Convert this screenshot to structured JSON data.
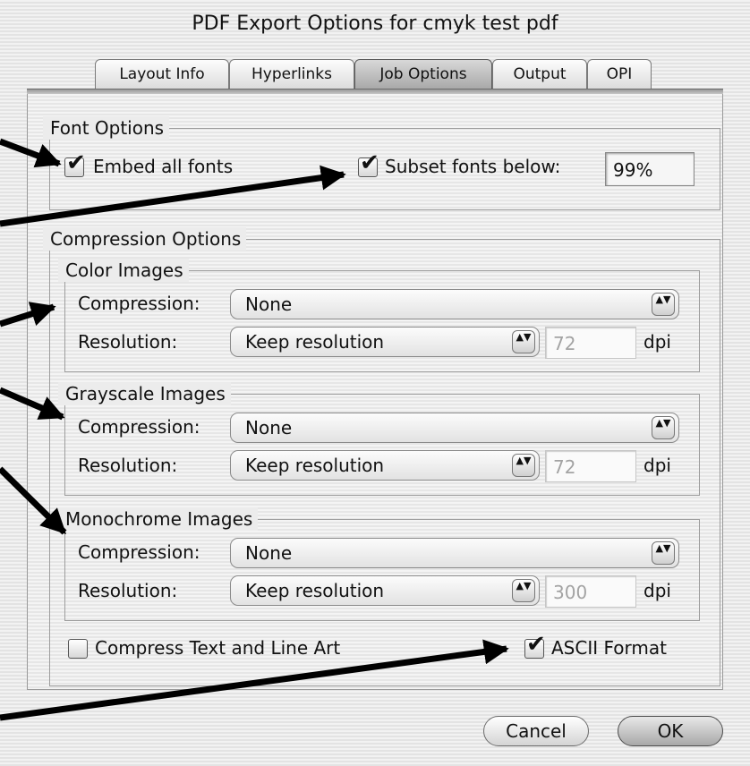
{
  "window": {
    "title": "PDF Export Options for cmyk test pdf"
  },
  "tabs": [
    {
      "label": "Layout Info",
      "selected": false
    },
    {
      "label": "Hyperlinks",
      "selected": false
    },
    {
      "label": "Job Options",
      "selected": true
    },
    {
      "label": "Output",
      "selected": false
    },
    {
      "label": "OPI",
      "selected": false
    }
  ],
  "font_options": {
    "title": "Font Options",
    "embed_all_fonts": {
      "label": "Embed all fonts",
      "checked": true
    },
    "subset_fonts": {
      "label": "Subset fonts below:",
      "checked": true,
      "value": "99%"
    }
  },
  "compression_options": {
    "title": "Compression Options",
    "color": {
      "title": "Color Images",
      "compression_label": "Compression:",
      "compression_value": "None",
      "resolution_label": "Resolution:",
      "resolution_value": "Keep resolution",
      "dpi_value": "72",
      "dpi_unit": "dpi"
    },
    "grayscale": {
      "title": "Grayscale Images",
      "compression_label": "Compression:",
      "compression_value": "None",
      "resolution_label": "Resolution:",
      "resolution_value": "Keep resolution",
      "dpi_value": "72",
      "dpi_unit": "dpi"
    },
    "monochrome": {
      "title": "Monochrome Images",
      "compression_label": "Compression:",
      "compression_value": "None",
      "resolution_label": "Resolution:",
      "resolution_value": "Keep resolution",
      "dpi_value": "300",
      "dpi_unit": "dpi"
    }
  },
  "compress_text": {
    "label": "Compress Text and Line Art",
    "checked": false
  },
  "ascii_format": {
    "label": "ASCII Format",
    "checked": true
  },
  "buttons": {
    "cancel": "Cancel",
    "ok": "OK"
  },
  "icons": {
    "checkmark": "✔",
    "updown": "▲▼"
  }
}
